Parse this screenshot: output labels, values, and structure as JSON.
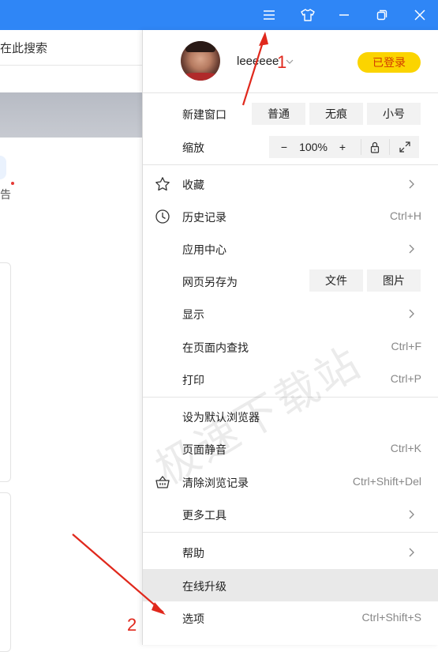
{
  "titlebar": {
    "background": "#2f86f6",
    "buttons": [
      {
        "name": "menu-icon"
      },
      {
        "name": "skin-icon"
      },
      {
        "name": "minimize-icon"
      },
      {
        "name": "restore-icon"
      },
      {
        "name": "close-icon"
      }
    ]
  },
  "background_page": {
    "search_label": "在此搜索",
    "notice_text": "告"
  },
  "menu": {
    "user": {
      "name": "leeeeee",
      "login_label": "已登录",
      "login_badge_color": "#fbd400"
    },
    "new_window": {
      "label": "新建窗口",
      "options": [
        "普通",
        "无痕",
        "小号"
      ]
    },
    "zoom": {
      "label": "缩放",
      "minus": "−",
      "value": "100%",
      "plus": "+"
    },
    "items": {
      "favorites": {
        "label": "收藏",
        "icon": "star-icon"
      },
      "history": {
        "label": "历史记录",
        "shortcut": "Ctrl+H",
        "icon": "clock-icon"
      },
      "app_center": {
        "label": "应用中心"
      },
      "save_page": {
        "label": "网页另存为",
        "options": [
          "文件",
          "图片"
        ]
      },
      "display": {
        "label": "显示"
      },
      "find": {
        "label": "在页面内查找",
        "shortcut": "Ctrl+F"
      },
      "print": {
        "label": "打印",
        "shortcut": "Ctrl+P"
      },
      "set_default": {
        "label": "设为默认浏览器"
      },
      "mute": {
        "label": "页面静音",
        "shortcut": "Ctrl+K"
      },
      "clear_data": {
        "label": "清除浏览记录",
        "shortcut": "Ctrl+Shift+Del",
        "icon": "basket-icon"
      },
      "more_tools": {
        "label": "更多工具"
      },
      "help": {
        "label": "帮助"
      },
      "upgrade": {
        "label": "在线升级"
      },
      "options": {
        "label": "选项",
        "shortcut": "Ctrl+Shift+S"
      }
    }
  },
  "watermark": "极速下载站",
  "annotations": {
    "one": "1",
    "two": "2",
    "color": "#e0281c"
  }
}
